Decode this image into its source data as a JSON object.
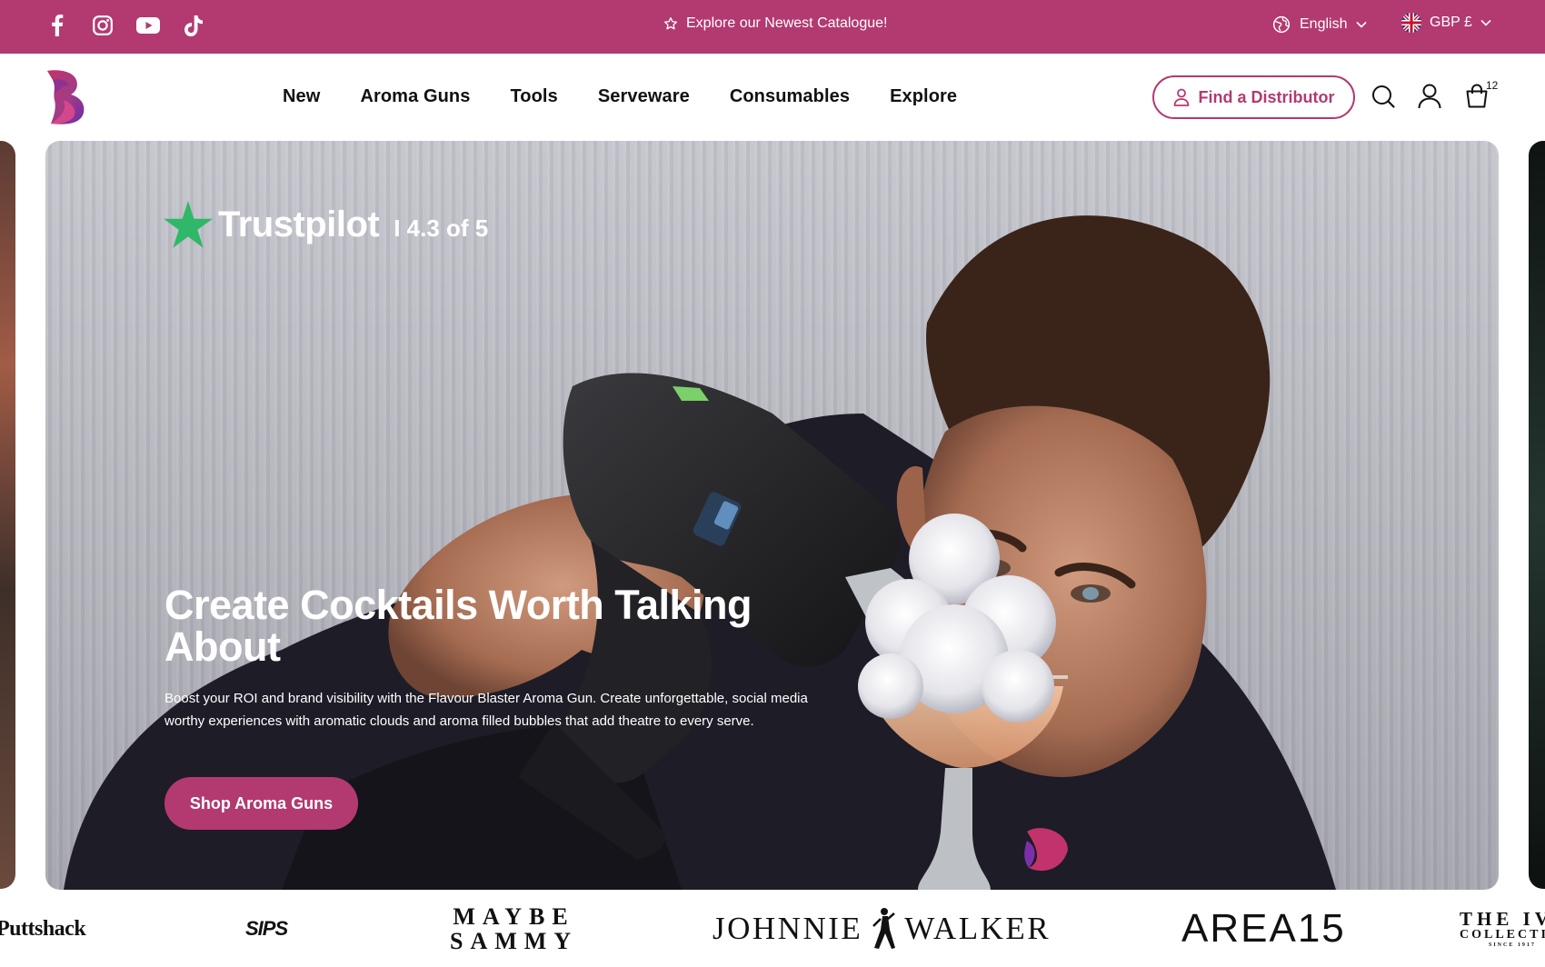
{
  "topbar": {
    "social_icons": [
      "facebook-icon",
      "instagram-icon",
      "youtube-icon",
      "tiktok-icon"
    ],
    "announcement": "Explore our Newest Catalogue!",
    "language": "English",
    "currency": "GBP £",
    "background_color": "#b23a70"
  },
  "header": {
    "nav": [
      "New",
      "Aroma Guns",
      "Tools",
      "Serveware",
      "Consumables",
      "Explore"
    ],
    "distributor_button": "Find a Distributor",
    "cart_count": "12"
  },
  "hero": {
    "trustpilot_name": "Trustpilot",
    "trustpilot_score": "I 4.3 of 5",
    "title": "Create Cocktails Worth Talking About",
    "description": "Boost your ROI and brand visibility with the Flavour Blaster Aroma Gun. Create unforgettable, social media worthy experiences with aromatic clouds and aroma filled bubbles that add theatre to every serve.",
    "cta": "Shop Aroma Guns"
  },
  "brands": {
    "puttshack": "Puttshack",
    "sips": "SIPS",
    "maybe_line1": "MAYBE",
    "maybe_line2": "SAMMY",
    "jw_left": "JOHNNIE",
    "jw_right": "WALKER",
    "area": "AREA15",
    "ivy_line1": "THE IVY",
    "ivy_line2": "COLLECTION",
    "ivy_line3": "SINCE 1917"
  },
  "colors": {
    "accent": "#b23a70",
    "trustpilot_green": "#2fb868"
  }
}
